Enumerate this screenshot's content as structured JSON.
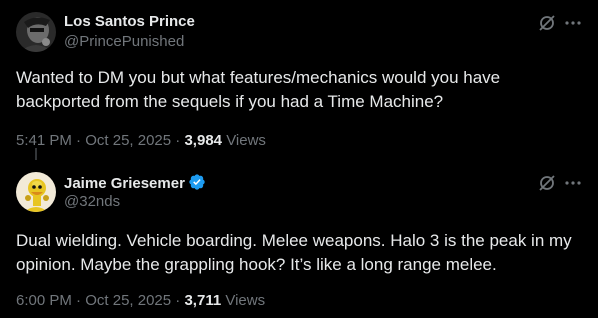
{
  "tweets": [
    {
      "name": "Los Santos Prince",
      "handle": "@PrincePunished",
      "text": "Wanted to DM you but what features/mechanics would you have backported from the sequels if you had a Time Machine?",
      "time": "5:41 PM",
      "date": "Oct 25, 2025",
      "separator": "·",
      "views_count": "3,984",
      "views_label": "Views",
      "verified": false
    },
    {
      "name": "Jaime Griesemer",
      "handle": "@32nds",
      "text": "Dual wielding. Vehicle boarding. Melee weapons. Halo 3 is the peak in my opinion. Maybe the grappling hook? It’s like a long range melee.",
      "time": "6:00 PM",
      "date": "Oct 25, 2025",
      "separator": "·",
      "views_count": "3,711",
      "views_label": "Views",
      "verified": true
    }
  ],
  "icons": {
    "verified_badge": "verified-badge-icon",
    "grok": "grok-icon",
    "more": "more-icon"
  },
  "colors": {
    "background": "#000000",
    "primary_text": "#e7e9ea",
    "secondary_text": "#71767b",
    "verified_blue": "#1d9bf0",
    "divider": "#333639"
  }
}
